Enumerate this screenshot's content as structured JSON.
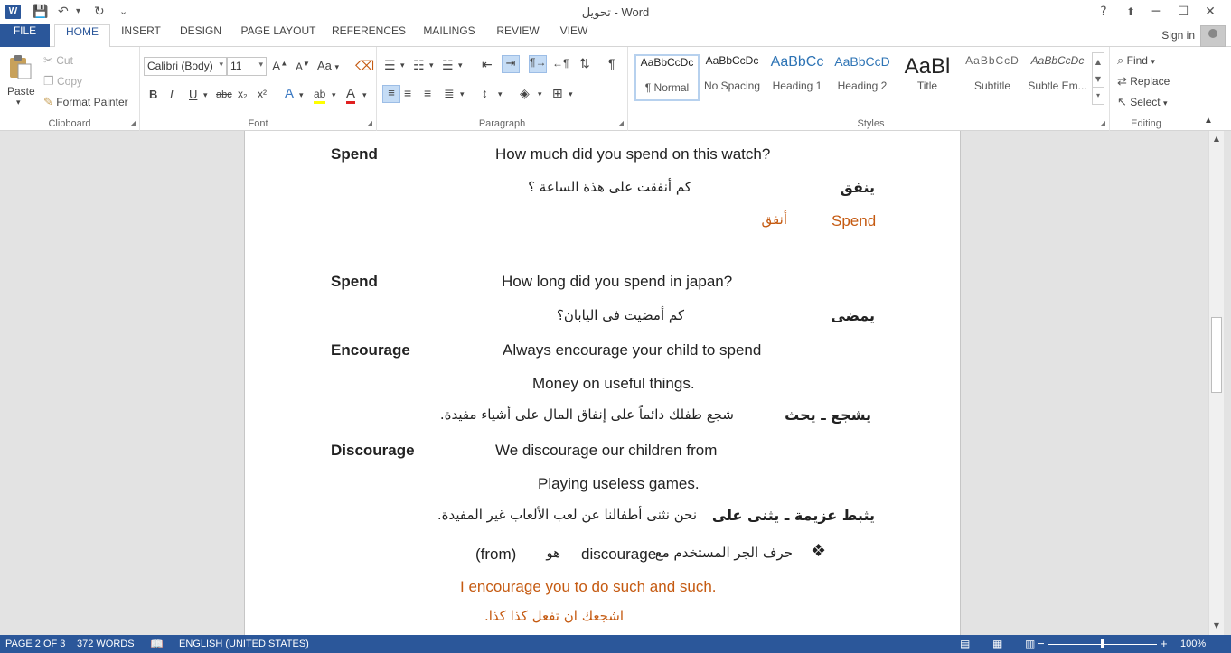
{
  "app": {
    "title": "تحويل - Word",
    "logo_letter": "W",
    "help": "?",
    "ribbon_display": "⬆",
    "minimize": "─",
    "restore": "☐",
    "close": "✕"
  },
  "quick_access": {
    "save": "💾",
    "undo": "↶",
    "undo_dd": "▾",
    "redo": "↻",
    "customize": "⌄"
  },
  "tabs": [
    {
      "label": "FILE"
    },
    {
      "label": "HOME"
    },
    {
      "label": "INSERT"
    },
    {
      "label": "DESIGN"
    },
    {
      "label": "PAGE LAYOUT"
    },
    {
      "label": "REFERENCES"
    },
    {
      "label": "MAILINGS"
    },
    {
      "label": "REVIEW"
    },
    {
      "label": "VIEW"
    }
  ],
  "account": {
    "signin": "Sign in"
  },
  "clipboard": {
    "label": "Clipboard",
    "paste": "Paste",
    "cut": "Cut",
    "copy": "Copy",
    "format_painter": "Format Painter"
  },
  "font": {
    "label": "Font",
    "family": "Calibri (Body)",
    "size": "11",
    "grow": "A",
    "shrink": "A",
    "case": "Aa",
    "bold": "B",
    "italic": "I",
    "underline": "U",
    "strike": "abc",
    "subscript": "x₂",
    "superscript": "x²",
    "effects": "A",
    "highlight": "ab",
    "color": "A"
  },
  "paragraph": {
    "label": "Paragraph",
    "pilcrow": "¶"
  },
  "styles": {
    "label": "Styles",
    "items": [
      {
        "preview": "AaBbCcDc",
        "name": "¶ Normal"
      },
      {
        "preview": "AaBbCcDc",
        "name": "No Spacing"
      },
      {
        "preview": "AaBbCc",
        "name": "Heading 1"
      },
      {
        "preview": "AaBbCcD",
        "name": "Heading 2"
      },
      {
        "preview": "AaBl",
        "name": "Title"
      },
      {
        "preview": "AaBbCcD",
        "name": "Subtitle"
      },
      {
        "preview": "AaBbCcDc",
        "name": "Subtle Em..."
      }
    ]
  },
  "editing": {
    "label": "Editing",
    "find": "Find",
    "replace": "Replace",
    "select": "Select"
  },
  "document": {
    "lines": [
      {
        "text": "Spend"
      },
      {
        "text": "How much did you spend on this watch?"
      },
      {
        "text": "ينفق"
      },
      {
        "text": "كم أنفقت على هذة الساعة ؟"
      },
      {
        "text": "Spend"
      },
      {
        "text": "أنفق"
      },
      {
        "text": "Spend"
      },
      {
        "text": "How long did you spend in japan?"
      },
      {
        "text": "يمضى"
      },
      {
        "text": "كم أمضيت فى اليابان؟"
      },
      {
        "text": "Encourage"
      },
      {
        "text": "Always encourage your child to spend"
      },
      {
        "text": "Money on useful things."
      },
      {
        "text": "يشجع ـ يحث"
      },
      {
        "text": "شجع طفلك دائماً على إنفاق المال على أشياء مفيدة."
      },
      {
        "text": "Discourage"
      },
      {
        "text": "We discourage our children from"
      },
      {
        "text": "Playing useless games."
      },
      {
        "text": "يثبط عزيمة ـ يثنى على"
      },
      {
        "text": "نحن نثنى أطفالنا عن لعب الألعاب غير المفيدة."
      },
      {
        "text": "❖"
      },
      {
        "text": "حرف الجر المستخدم مع"
      },
      {
        "text": "discourage"
      },
      {
        "text": "هو"
      },
      {
        "text": "(from)"
      },
      {
        "text": "I encourage you to do such and such."
      },
      {
        "text": "اشجعك ان تفعل كذا كذا."
      }
    ]
  },
  "status": {
    "page": "PAGE 2 OF 3",
    "words": "372 WORDS",
    "language": "ENGLISH (UNITED STATES)",
    "zoom": "100%",
    "zoom_minus": "−",
    "zoom_plus": "+"
  },
  "colors": {
    "accent": "#2b579a",
    "orange_text": "#c55a11"
  }
}
